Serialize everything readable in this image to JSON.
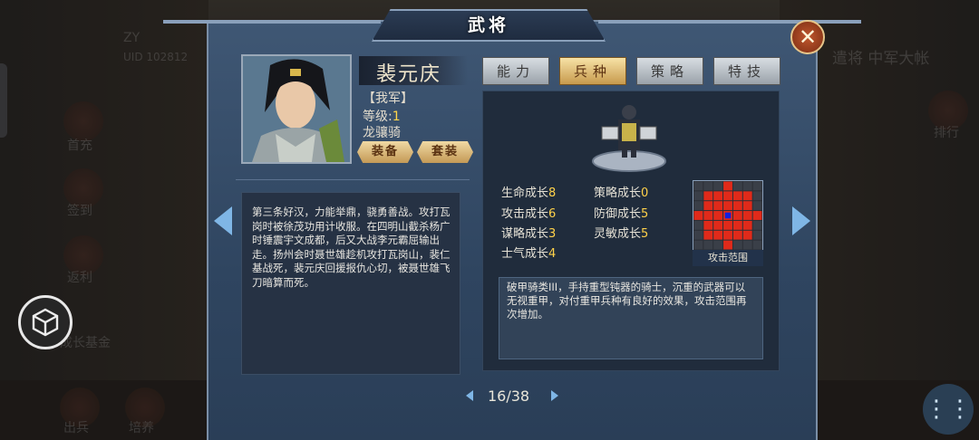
{
  "dialog": {
    "title": "武将",
    "close_symbol": "✕"
  },
  "background": {
    "player_name": "ZY",
    "player_uid": "UID 102812",
    "right_header": "遣将  中军大帐",
    "right_side_label": "排行",
    "left_menu": [
      "首充",
      "签到",
      "返利",
      "成长基金"
    ],
    "bottom_menu": [
      "出兵",
      "培养"
    ]
  },
  "general": {
    "name": "裴元庆",
    "faction": "【我军】",
    "level_label": "等级:",
    "level_value": "1",
    "unit_type": "龙骧骑",
    "equip_button": "装备",
    "set_button": "套装",
    "description": "第三条好汉，力能举鼎，骁勇善战。攻打瓦岗时被徐茂功用计收服。在四明山截杀杨广时锤震宇文成都，后又大战李元霸屈输出走。扬州会时聂世雄趁机攻打瓦岗山，裴仁基战死，裴元庆回援报仇心切，被聂世雄飞刀暗算而死。"
  },
  "tabs": [
    {
      "label": "能力",
      "active": false
    },
    {
      "label": "兵种",
      "active": true
    },
    {
      "label": "策略",
      "active": false
    },
    {
      "label": "特技",
      "active": false
    }
  ],
  "stats": {
    "left": [
      {
        "label": "生命成长",
        "value": "8"
      },
      {
        "label": "攻击成长",
        "value": "6"
      },
      {
        "label": "谋略成长",
        "value": "3"
      },
      {
        "label": "士气成长",
        "value": "4"
      }
    ],
    "right": [
      {
        "label": "策略成长",
        "value": "0"
      },
      {
        "label": "防御成长",
        "value": "5"
      },
      {
        "label": "灵敏成长",
        "value": "5"
      }
    ]
  },
  "attack_range": {
    "label": "攻击范围",
    "range_color": "#e02a1a",
    "center_color": "#1020e0"
  },
  "skill": {
    "description": "破甲骑类III，手持重型钝器的骑士，沉重的武器可以无视重甲，对付重甲兵种有良好的效果，攻击范围再次增加。"
  },
  "pager": {
    "text": "16/38"
  },
  "colors": {
    "accent_gold": "#ffd24a",
    "tab_active": "#f7e2a6",
    "arrow": "#7fb6e6"
  }
}
